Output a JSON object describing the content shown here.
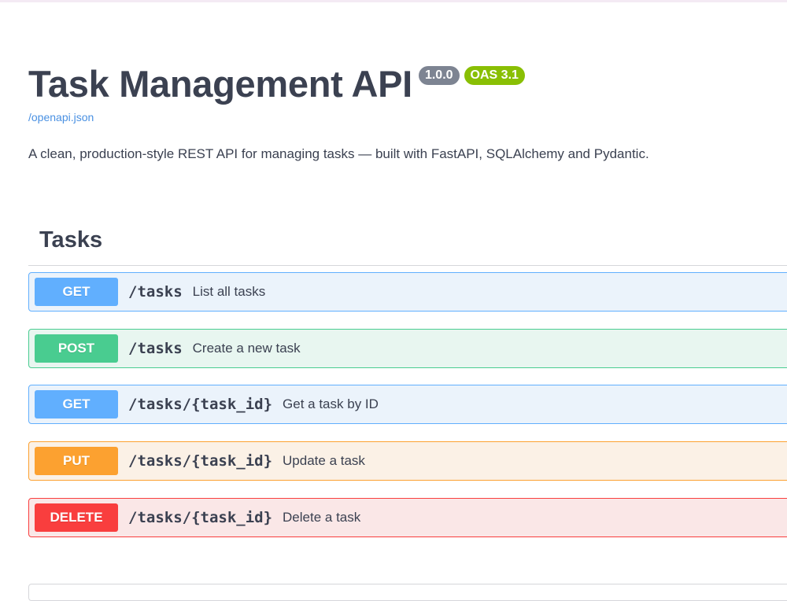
{
  "info": {
    "title": "Task Management API",
    "version": "1.0.0",
    "oas": "OAS 3.1",
    "spec_link": "/openapi.json",
    "description": "A clean, production-style REST API for managing tasks — built with FastAPI, SQLAlchemy and Pydantic."
  },
  "tag": {
    "name": "Tasks"
  },
  "operations": [
    {
      "method": "GET",
      "path": "/tasks",
      "summary": "List all tasks"
    },
    {
      "method": "POST",
      "path": "/tasks",
      "summary": "Create a new task"
    },
    {
      "method": "GET",
      "path": "/tasks/{task_id}",
      "summary": "Get a task by ID"
    },
    {
      "method": "PUT",
      "path": "/tasks/{task_id}",
      "summary": "Update a task"
    },
    {
      "method": "DELETE",
      "path": "/tasks/{task_id}",
      "summary": "Delete a task"
    }
  ],
  "colors": {
    "get": "#61affe",
    "post": "#49cc90",
    "put": "#fca130",
    "delete": "#f93e3e",
    "link": "#4990e2",
    "oas_badge": "#89bf04",
    "version_badge": "#7d8492"
  }
}
